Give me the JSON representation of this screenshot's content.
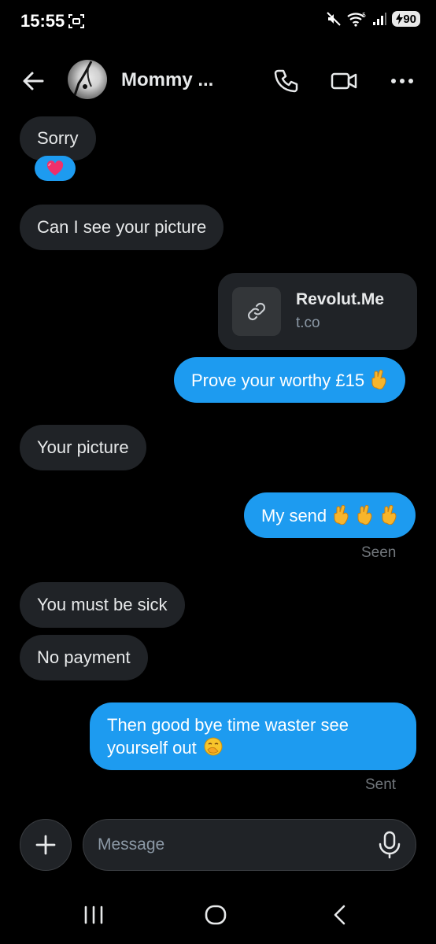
{
  "status_bar": {
    "time": "15:55",
    "battery": "90"
  },
  "header": {
    "contact_name": "Mommy ..."
  },
  "messages": [
    {
      "direction": "in",
      "text": "Sorry",
      "reaction": "heart"
    },
    {
      "direction": "in",
      "text": "Can I see your picture"
    },
    {
      "direction": "out",
      "type": "link",
      "title": "Revolut.Me",
      "domain": "t.co"
    },
    {
      "direction": "out",
      "text": "Prove your worthy £15"
    },
    {
      "direction": "in",
      "text": "Your picture"
    },
    {
      "direction": "out",
      "text": "My send",
      "status": "Seen"
    },
    {
      "direction": "in",
      "text": "You must be sick"
    },
    {
      "direction": "in",
      "text": "No payment"
    },
    {
      "direction": "out",
      "text_line1": "Then good bye time waster see",
      "text_line2": "yourself out",
      "status": "Sent"
    }
  ],
  "composer": {
    "placeholder": "Message"
  },
  "colors": {
    "background": "#000000",
    "incoming_bubble": "#202327",
    "outgoing_bubble": "#1d9bf0",
    "meta_text": "#71767b"
  }
}
